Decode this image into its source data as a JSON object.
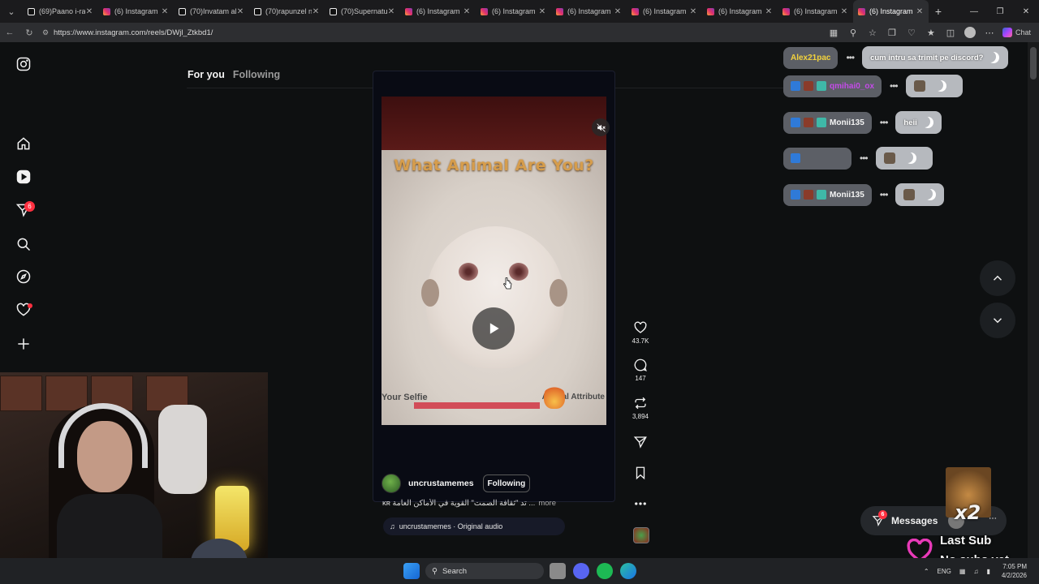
{
  "browser": {
    "tabs": [
      {
        "title": "(69)Paano i-ra",
        "icon": "tiktok-icon",
        "active": false
      },
      {
        "title": "(6) Instagram",
        "icon": "instagram-icon",
        "active": false
      },
      {
        "title": "(70)Invatam all",
        "icon": "tiktok-icon",
        "active": false
      },
      {
        "title": "(70)rapunzel n",
        "icon": "tiktok-icon",
        "active": false
      },
      {
        "title": "(70)Supernatur",
        "icon": "tiktok-icon",
        "active": false
      },
      {
        "title": "(6) Instagram",
        "icon": "instagram-icon",
        "active": false
      },
      {
        "title": "(6) Instagram",
        "icon": "instagram-icon",
        "active": false
      },
      {
        "title": "(6) Instagram",
        "icon": "instagram-icon",
        "active": false
      },
      {
        "title": "(6) Instagram",
        "icon": "instagram-icon",
        "active": false
      },
      {
        "title": "(6) Instagram",
        "icon": "instagram-icon",
        "active": false
      },
      {
        "title": "(6) Instagram",
        "icon": "instagram-icon",
        "active": false
      },
      {
        "title": "(6) Instagram",
        "icon": "instagram-icon",
        "active": true
      }
    ],
    "url": "https://www.instagram.com/reels/DWjl_Ztkbd1/",
    "chat_label": "Chat"
  },
  "instagram": {
    "feed_tabs": {
      "for_you": "For you",
      "following": "Following"
    },
    "nav": {
      "notifications_badge": "6"
    },
    "reel": {
      "headline": "What Animal Are You?",
      "overlay_left": "Your Selfie",
      "overlay_right": "Animal Attribute",
      "author": "uncrustamemes",
      "follow_label": "Following",
      "caption": "ᴋʀ تد \"ثقافة الصمت\" القوية في الأماكن العامة ...",
      "more_label": "more",
      "audio": "uncrustamemes · Original audio",
      "likes": "43.7K",
      "comments": "147",
      "reposts": "3,894"
    },
    "messages": {
      "label": "Messages",
      "badge": "6"
    }
  },
  "stream_chat": [
    {
      "user": "Alex21pac",
      "user_color": "#f2d23c",
      "message": "cum intru sa trimit pe discord?"
    },
    {
      "user": "qmihai0_ox",
      "user_color": "#c44be8",
      "message": ""
    },
    {
      "user": "Monii135",
      "user_color": "#f4f4f4",
      "message": "heii"
    },
    {
      "user": "",
      "user_color": "#e23a5a",
      "message": ""
    },
    {
      "user": "Monii135",
      "user_color": "#f4f4f4",
      "message": ""
    }
  ],
  "stream_overlay": {
    "multiplier": "x2",
    "last_sub_label": "Last Sub",
    "last_sub_value": "No subs yet"
  },
  "taskbar": {
    "search_label": "Search",
    "language": "ENG",
    "time": "7:05 PM",
    "date": "4/2/2026"
  }
}
